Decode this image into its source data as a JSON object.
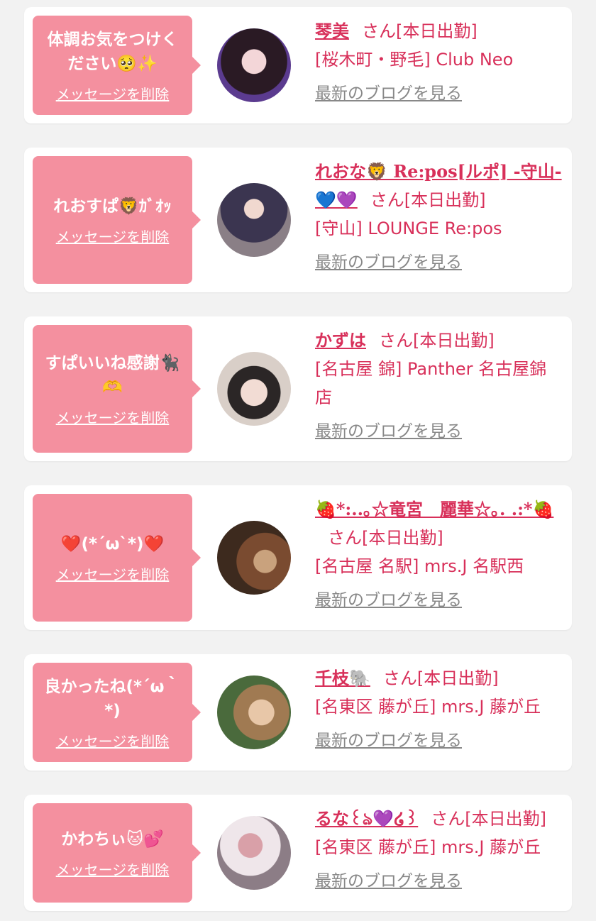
{
  "messages": [
    {
      "message": "体調お気をつけください🥺✨",
      "delete_label": "メッセージを削除",
      "name": "琴美",
      "san": "さん",
      "status": "[本日出勤]",
      "shop": "[桜木町・野毛] Club Neo",
      "blog_label": "最新のブログを見る"
    },
    {
      "message": "れおすぱ🦁ｶﾞｵｯ",
      "delete_label": "メッセージを削除",
      "name": "れおな🦁 Re:pos[ルポ] -守山-💙💜",
      "san": "さん",
      "status": "[本日出勤]",
      "shop": "[守山] LOUNGE Re:pos",
      "blog_label": "最新のブログを見る"
    },
    {
      "message": "すぱいいね感謝🐈‍⬛🫶",
      "delete_label": "メッセージを削除",
      "name": "かずは",
      "san": "さん",
      "status": "[本日出勤]",
      "shop": "[名古屋 錦] Panther 名古屋錦店",
      "blog_label": "最新のブログを見る"
    },
    {
      "message": "❤️(*´ω`*)❤️",
      "delete_label": "メッセージを削除",
      "name": "🍓*:..｡☆竜宮　麗華☆｡. .:*🍓",
      "san": "さん",
      "status": "[本日出勤]",
      "shop": "[名古屋 名駅] mrs.J 名駅西",
      "blog_label": "最新のブログを見る"
    },
    {
      "message": "良かったね(*´ω｀*)",
      "delete_label": "メッセージを削除",
      "name": "千枝🐘",
      "san": "さん",
      "status": "[本日出勤]",
      "shop": "[名東区 藤が丘] mrs.J 藤が丘",
      "blog_label": "最新のブログを見る"
    },
    {
      "message": "かわちぃ🐱💕",
      "delete_label": "メッセージを削除",
      "name": "るな꒰ঌ💜໒꒱",
      "san": "さん",
      "status": "[本日出勤]",
      "shop": "[名東区 藤が丘] mrs.J 藤が丘",
      "blog_label": "最新のブログを見る"
    }
  ],
  "colors": {
    "bubble": "#f4909f",
    "accent": "#d8305a",
    "muted_link": "#888888",
    "page_bg": "#f2f2f2"
  }
}
